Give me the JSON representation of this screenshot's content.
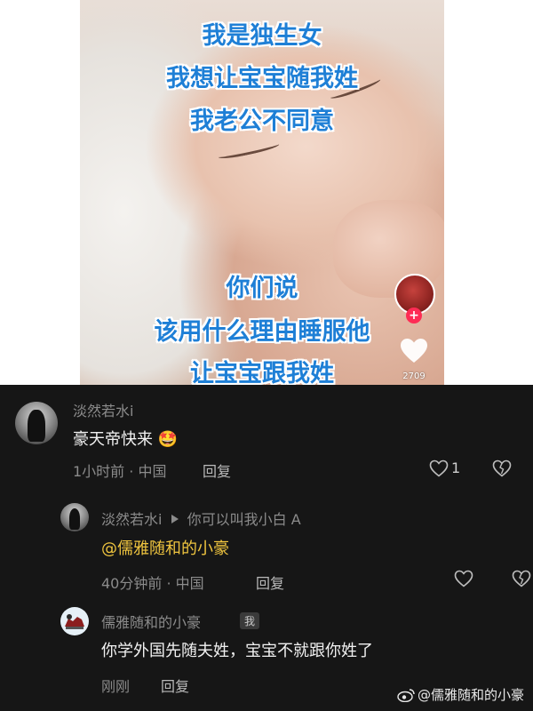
{
  "video": {
    "caption_top": [
      "我是独生女",
      "我想让宝宝随我姓",
      "我老公不同意"
    ],
    "caption_bottom": [
      "你们说",
      "该用什么理由睡服他",
      "让宝宝跟我姓"
    ],
    "follow_plus": "+",
    "like_count": "2709"
  },
  "comments": [
    {
      "author": "淡然若水i",
      "text": "豪天帝快来",
      "emoji": "🤩",
      "time": "1小时前 · 中国",
      "reply_label": "回复",
      "like_count": "1"
    },
    {
      "author": "淡然若水i",
      "reply_to": "你可以叫我小白 A",
      "mention": "@儒雅随和的小豪",
      "time": "40分钟前 · 中国",
      "reply_label": "回复"
    },
    {
      "author": "儒雅随和的小豪",
      "badge": "我",
      "text": "你学外国先随夫姓，宝宝不就跟你姓了",
      "time": "刚刚",
      "reply_label": "回复"
    }
  ],
  "watermark": "@儒雅随和的小豪",
  "colors": {
    "caption_blue": "#1e7fd6",
    "mention_yellow": "#f0c53f",
    "comment_bg": "#161616",
    "follow_red": "#fe2c55"
  },
  "icons": [
    "heart-icon",
    "like-outline-icon",
    "dislike-broken-heart-icon",
    "play-triangle-icon",
    "weibo-icon"
  ]
}
